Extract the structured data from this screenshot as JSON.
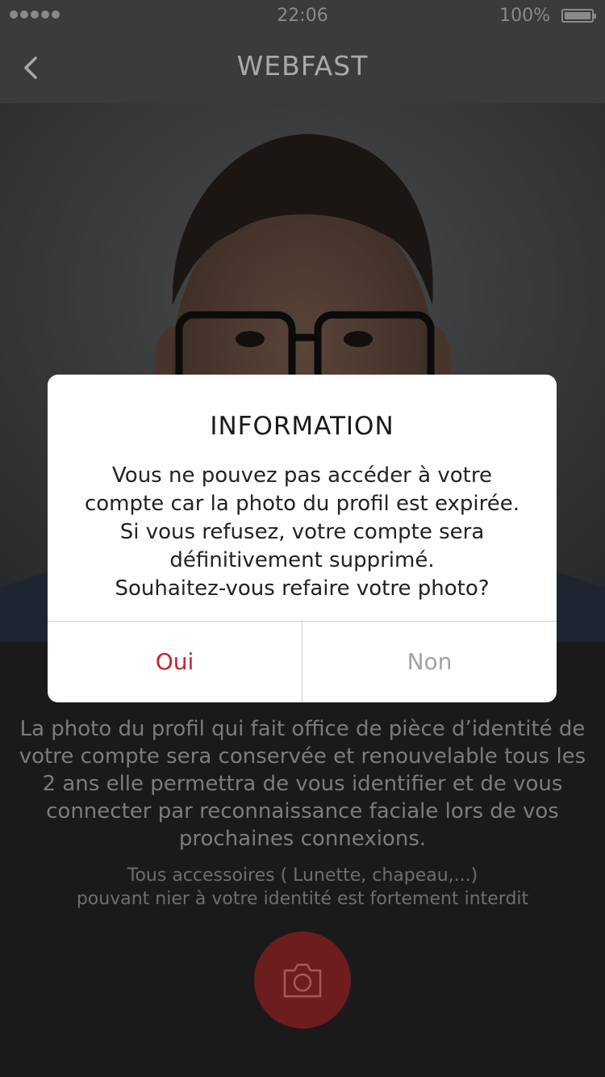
{
  "status_bar": {
    "time": "22:06",
    "battery": "100%",
    "battery_level": 1.0,
    "signal_bars": 5
  },
  "nav": {
    "title": "WEBFAST",
    "back_icon": "chevron-left-icon"
  },
  "content": {
    "description": "La photo du profil qui fait office de pièce d’identité de votre compte sera conservée et renouvelable tous les 2 ans elle permettra de vous identifier et de vous connecter par reconnaissance faciale lors de vos prochaines connexions.",
    "notice_line1": "Tous accessoires ( Lunette, chapeau,...)",
    "notice_line2": "pouvant nier  à votre identité est fortement interdit",
    "camera_icon": "camera-icon"
  },
  "dialog": {
    "title": "INFORMATION",
    "line1": "Vous ne pouvez pas accéder à votre",
    "line2": "compte car la photo du profil est expirée.",
    "line3": "Si vous refusez, votre compte sera",
    "line4": "définitivement supprimé.",
    "line5": "Souhaitez-vous refaire votre photo?",
    "yes_label": "Oui",
    "no_label": "Non"
  },
  "colors": {
    "accent": "#c0262c",
    "camera_button": "#6d1d1d",
    "background": "#1a1a1a"
  }
}
